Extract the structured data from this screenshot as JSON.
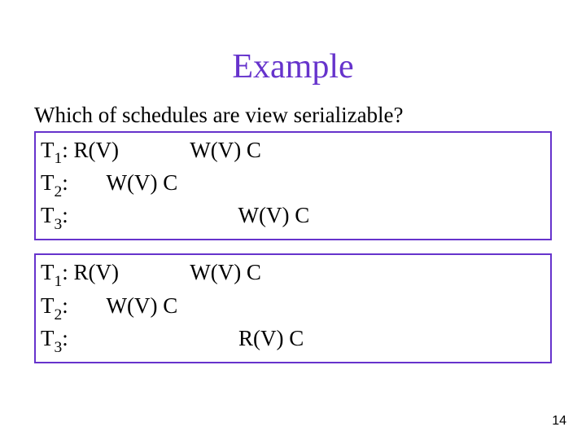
{
  "title": "Example",
  "question": "Which of schedules are view serializable?",
  "schedule1": {
    "t1": {
      "label": "T",
      "sub": "1",
      "rest": ": R(V)             W(V) C"
    },
    "t2": {
      "label": "T",
      "sub": "2",
      "rest": ":       W(V) C"
    },
    "t3": {
      "label": "T",
      "sub": "3",
      "rest": ":                               W(V) C"
    }
  },
  "schedule2": {
    "t1": {
      "label": "T",
      "sub": "1",
      "rest": ": R(V)             W(V) C"
    },
    "t2": {
      "label": "T",
      "sub": "2",
      "rest": ":       W(V) C"
    },
    "t3": {
      "label": "T",
      "sub": "3",
      "rest": ":                               R(V) C"
    }
  },
  "page": "14"
}
